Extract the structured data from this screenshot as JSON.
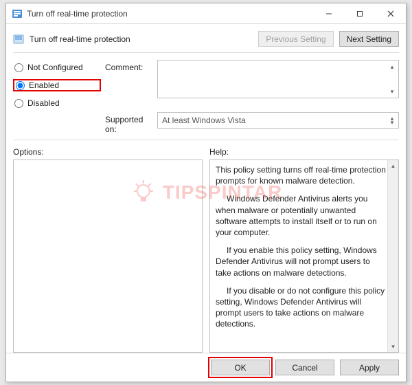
{
  "window": {
    "title": "Turn off real-time protection"
  },
  "header": {
    "title": "Turn off real-time protection",
    "prev_btn": "Previous Setting",
    "next_btn": "Next Setting"
  },
  "state": {
    "options": [
      {
        "value": "not_configured",
        "label": "Not Configured"
      },
      {
        "value": "enabled",
        "label": "Enabled"
      },
      {
        "value": "disabled",
        "label": "Disabled"
      }
    ],
    "selected": "enabled",
    "comment_label": "Comment:",
    "comment_value": "",
    "supported_label": "Supported on:",
    "supported_value": "At least Windows Vista"
  },
  "panels": {
    "options_label": "Options:",
    "help_label": "Help:",
    "help_paragraphs": [
      "This policy setting turns off real-time protection prompts for known malware detection.",
      "Windows Defender Antivirus alerts you when malware or potentially unwanted software attempts to install itself or to run on your computer.",
      "If you enable this policy setting, Windows Defender Antivirus will not prompt users to take actions on malware detections.",
      "If you disable or do not configure this policy setting, Windows Defender Antivirus will prompt users to take actions on malware detections."
    ]
  },
  "footer": {
    "ok": "OK",
    "cancel": "Cancel",
    "apply": "Apply"
  },
  "watermark": "TIPSPINTAR"
}
